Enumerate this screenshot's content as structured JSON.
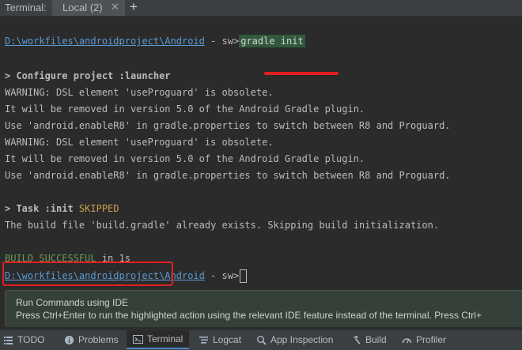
{
  "terminal_tabs": {
    "title": "Terminal:",
    "tab_label": "Local (2)",
    "close_glyph": "✕",
    "add_glyph": "+"
  },
  "console": {
    "prompt_path": "D:\\workfiles\\androidproject\\Android",
    "prompt_suffix": " - sw>",
    "command": "gradle init",
    "configure_line": "> Configure project :launcher",
    "w1": "WARNING: DSL element 'useProguard' is obsolete.",
    "w2": "It will be removed in version 5.0 of the Android Gradle plugin.",
    "w3": "Use 'android.enableR8' in gradle.properties to switch between R8 and Proguard.",
    "w4": "WARNING: DSL element 'useProguard' is obsolete.",
    "w5": "It will be removed in version 5.0 of the Android Gradle plugin.",
    "w6": "Use 'android.enableR8' in gradle.properties to switch between R8 and Proguard.",
    "task_prefix": "> Task :init ",
    "task_status": "SKIPPED",
    "build_file_line": "The build file 'build.gradle' already exists. Skipping build initialization.",
    "build_status": "BUILD SUCCESSFUL",
    "build_time": " in 1s",
    "prompt2_path": "D:\\workfiles\\androidproject\\Android",
    "prompt2_suffix": " - sw>"
  },
  "tip": {
    "title": "Run Commands using IDE",
    "body": "Press Ctrl+Enter to run the highlighted action using the relevant IDE feature instead of the terminal. Press Ctrl+"
  },
  "status_bar": {
    "items": [
      {
        "label": "TODO",
        "icon": "list-icon"
      },
      {
        "label": "Problems",
        "icon": "info-icon"
      },
      {
        "label": "Terminal",
        "icon": "terminal-icon"
      },
      {
        "label": "Logcat",
        "icon": "logcat-icon"
      },
      {
        "label": "App Inspection",
        "icon": "app-inspection-icon"
      },
      {
        "label": "Build",
        "icon": "hammer-icon"
      },
      {
        "label": "Profiler",
        "icon": "profiler-icon"
      }
    ],
    "active": "Terminal"
  },
  "colors": {
    "background": "#2b2b2b",
    "path_link": "#5b9bd5",
    "command_highlight": "#32593d",
    "skipped": "#c7a24d",
    "success": "#6a9955",
    "annotation_red": "#e02020"
  }
}
